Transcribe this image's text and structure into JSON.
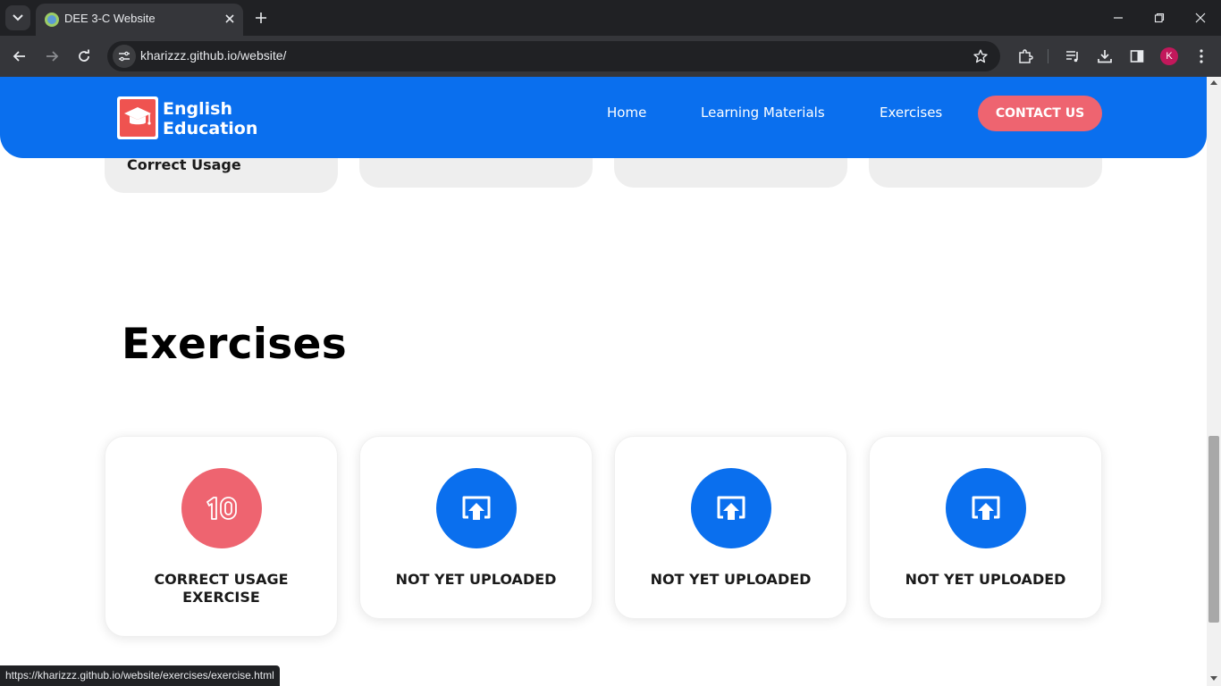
{
  "browser": {
    "tab_title": "DEE 3-C Website",
    "url": "kharizzz.github.io/website/",
    "profile_initial": "K",
    "status_url": "https://kharizzz.github.io/website/exercises/exercise.html"
  },
  "header": {
    "logo_line1": "English",
    "logo_line2": "Education",
    "nav": [
      "Home",
      "Learning Materials",
      "Exercises"
    ],
    "contact_label": "CONTACT US"
  },
  "prev_section": {
    "cards": [
      "Correct Usage",
      "",
      "",
      ""
    ]
  },
  "exercises": {
    "title": "Exercises",
    "cards": [
      {
        "label": "CORRECT USAGE EXERCISE",
        "icon": "number-10-icon",
        "color": "#ee6470"
      },
      {
        "label": "NOT YET UPLOADED",
        "icon": "upload-icon",
        "color": "#0a6fee"
      },
      {
        "label": "NOT YET UPLOADED",
        "icon": "upload-icon",
        "color": "#0a6fee"
      },
      {
        "label": "NOT YET UPLOADED",
        "icon": "upload-icon",
        "color": "#0a6fee"
      }
    ]
  }
}
